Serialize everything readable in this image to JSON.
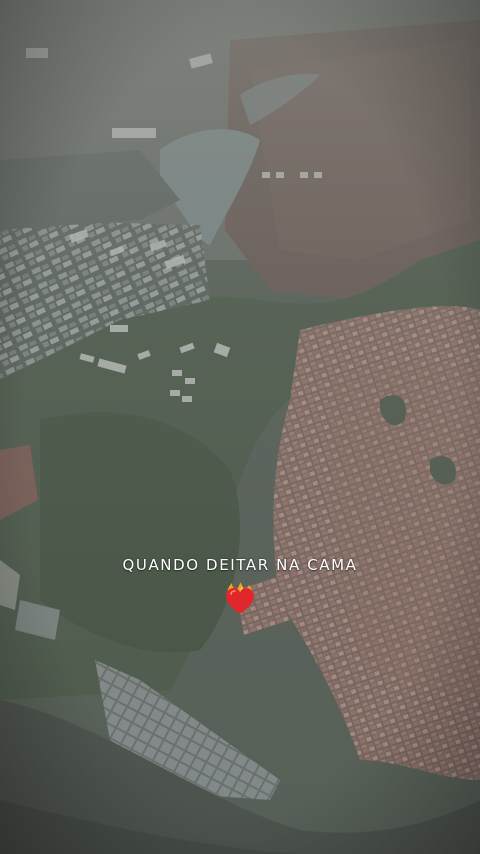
{
  "story": {
    "caption": "QUANDO DEITAR NA CAMA",
    "sticker": "heart-on-fire-icon"
  }
}
